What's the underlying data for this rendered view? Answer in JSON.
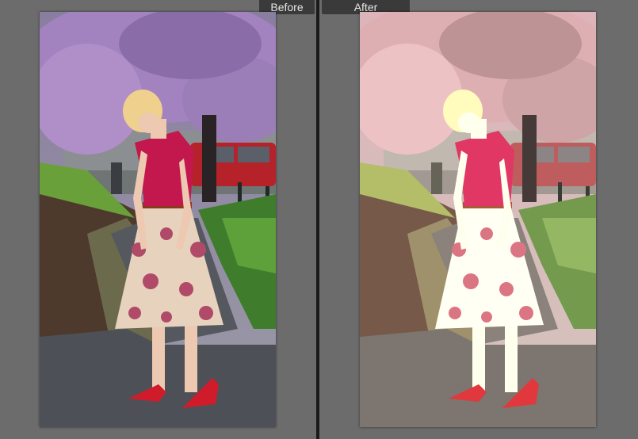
{
  "labels": {
    "before": "Before",
    "after": "After"
  },
  "colors": {
    "background": "#6a6a6a",
    "tab": "#3a3a3a",
    "divider": "#1a1a1a",
    "blossom": "#b48ac8",
    "shirt": "#c2184e",
    "shoes": "#d01c2a",
    "foliage": "#3f7d2c",
    "path": "#4e5057"
  }
}
